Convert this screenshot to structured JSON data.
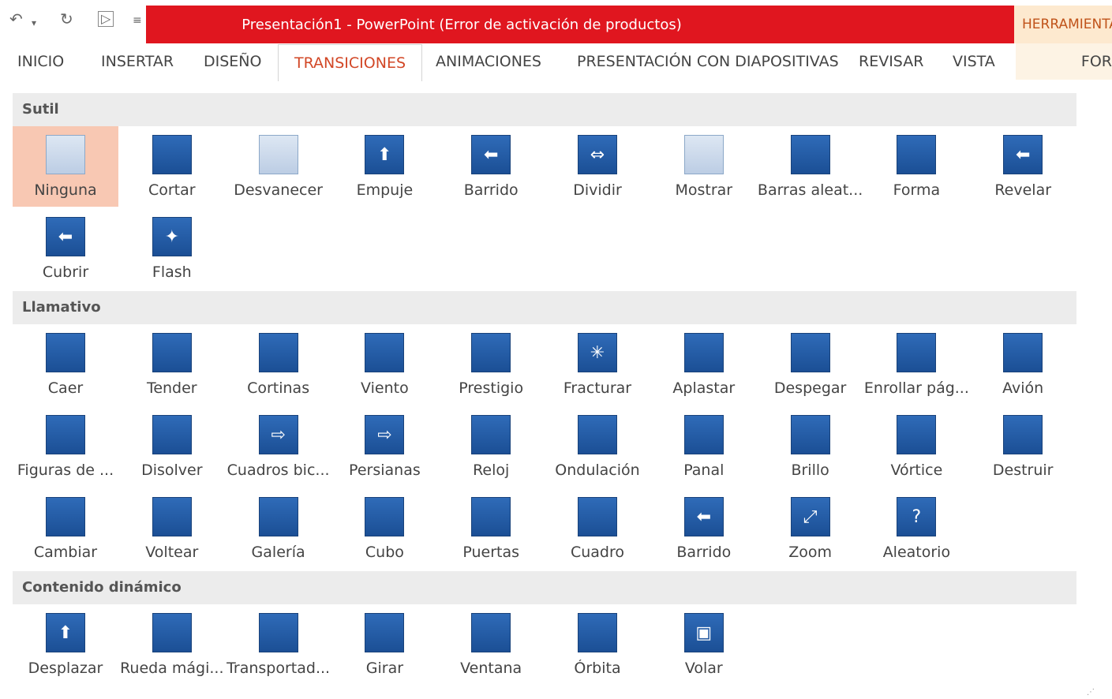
{
  "window": {
    "title": "Presentación1 -  PowerPoint (Error de activación de productos)",
    "contextual_tab": "HERRAMIENTAS"
  },
  "quick_access": [
    "undo-icon",
    "redo-icon",
    "start-from-beginning-icon",
    "customize-icon"
  ],
  "tabs": [
    {
      "label": "INICIO"
    },
    {
      "label": "INSERTAR"
    },
    {
      "label": "DISEÑO"
    },
    {
      "label": "TRANSICIONES"
    },
    {
      "label": "ANIMACIONES"
    },
    {
      "label": "PRESENTACIÓN CON DIAPOSITIVAS"
    },
    {
      "label": "REVISAR"
    },
    {
      "label": "VISTA"
    },
    {
      "label": "FOR"
    }
  ],
  "colors": {
    "accent": "#d24726",
    "title_bar": "#e0161f",
    "selected": "#f8c8b3",
    "icon_blue": "#2f6bb8"
  },
  "sections": [
    {
      "title": "Sutil",
      "items": [
        "Ninguna",
        "Cortar",
        "Desvanecer",
        "Empuje",
        "Barrido",
        "Dividir",
        "Mostrar",
        "Barras aleat...",
        "Forma",
        "Revelar",
        "Cubrir",
        "Flash"
      ]
    },
    {
      "title": "Llamativo",
      "items": [
        "Caer",
        "Tender",
        "Cortinas",
        "Viento",
        "Prestigio",
        "Fracturar",
        "Aplastar",
        "Despegar",
        "Enrollar pág...",
        "Avión",
        "Figuras de ...",
        "Disolver",
        "Cuadros bic...",
        "Persianas",
        "Reloj",
        "Ondulación",
        "Panal",
        "Brillo",
        "Vórtice",
        "Destruir",
        "Cambiar",
        "Voltear",
        "Galería",
        "Cubo",
        "Puertas",
        "Cuadro",
        "Barrido",
        "Zoom",
        "Aleatorio"
      ]
    },
    {
      "title": "Contenido dinámico",
      "items": [
        "Desplazar",
        "Rueda mági...",
        "Transportad...",
        "Girar",
        "Ventana",
        "Órbita",
        "Volar"
      ]
    }
  ],
  "selected_item": "Ninguna"
}
